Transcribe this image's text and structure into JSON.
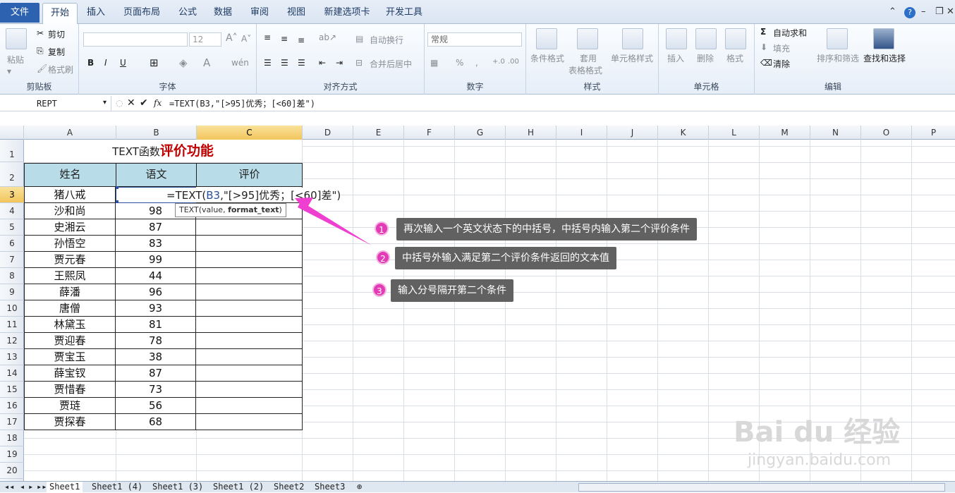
{
  "tabs": [
    "文件",
    "开始",
    "插入",
    "页面布局",
    "公式",
    "数据",
    "审阅",
    "视图",
    "新建选项卡",
    "开发工具"
  ],
  "ribbon": {
    "clipboard": {
      "paste": "粘贴",
      "cut": "剪切",
      "copy": "复制",
      "format_painter": "格式刷",
      "label": "剪贴板"
    },
    "font": {
      "size": "12",
      "bold": "B",
      "italic": "I",
      "underline": "U",
      "label": "字体"
    },
    "align": {
      "wrap": "自动换行",
      "merge": "合并后居中",
      "label": "对齐方式"
    },
    "number": {
      "format": "常规",
      "percent": "%",
      "comma": ",",
      "label": "数字"
    },
    "style": {
      "conditional": "条件格式",
      "table1": "套用",
      "table2": "表格格式",
      "cell_style": "单元格样式",
      "label": "样式"
    },
    "cells": {
      "insert": "插入",
      "delete": "删除",
      "format": "格式",
      "label": "单元格"
    },
    "edit": {
      "autosum": "自动求和",
      "fill": "填充",
      "clear": "清除",
      "sort": "排序和筛选",
      "find": "查找和选择",
      "label": "编辑"
    }
  },
  "formula_bar": {
    "name_box": "REPT",
    "fx": "fx",
    "formula": "=TEXT(B3,\"[>95]优秀；[<60]差\")"
  },
  "columns": [
    "A",
    "B",
    "C",
    "D",
    "E",
    "F",
    "G",
    "H",
    "I",
    "J",
    "K",
    "L",
    "M",
    "N",
    "O",
    "P"
  ],
  "rows": [
    "1",
    "2",
    "3",
    "4",
    "5",
    "6",
    "7",
    "8",
    "9",
    "10",
    "11",
    "12",
    "13",
    "14",
    "15",
    "16",
    "17",
    "18",
    "19",
    "20"
  ],
  "sheet": {
    "title_prefix": "TEXT函数",
    "title_emph": "评价功能",
    "headers": [
      "姓名",
      "语文",
      "评价"
    ],
    "names": [
      "猪八戒",
      "沙和尚",
      "史湘云",
      "孙悟空",
      "贾元春",
      "王熙凤",
      "薛潘",
      "唐僧",
      "林黛玉",
      "贾迎春",
      "贾宝玉",
      "薛宝钗",
      "贾惜春",
      "贾琏",
      "贾探春"
    ],
    "scores": [
      "",
      "98",
      "87",
      "83",
      "99",
      "44",
      "96",
      "93",
      "81",
      "78",
      "38",
      "87",
      "73",
      "56",
      "68"
    ],
    "edit_pre": "=TEXT(",
    "edit_ref": "B3",
    "edit_post": ",\"[>95]优秀；[<60]差\")",
    "tooltip_a": "TEXT(value, ",
    "tooltip_b": "format_text",
    ")": ")"
  },
  "callouts": [
    {
      "n": "1",
      "text": "再次输入一个英文状态下的中括号，中括号内输入第二个评价条件"
    },
    {
      "n": "2",
      "text": "中括号外输入满足第二个评价条件返回的文本值"
    },
    {
      "n": "3",
      "text": "输入分号隔开第二个条件"
    }
  ],
  "sheet_tabs": [
    "Sheet1",
    "Sheet1 (4)",
    "Sheet1 (3)",
    "Sheet1 (2)",
    "Sheet2",
    "Sheet3"
  ],
  "watermark": "Bai du 经验",
  "watermark2": "jingyan.baidu.com"
}
